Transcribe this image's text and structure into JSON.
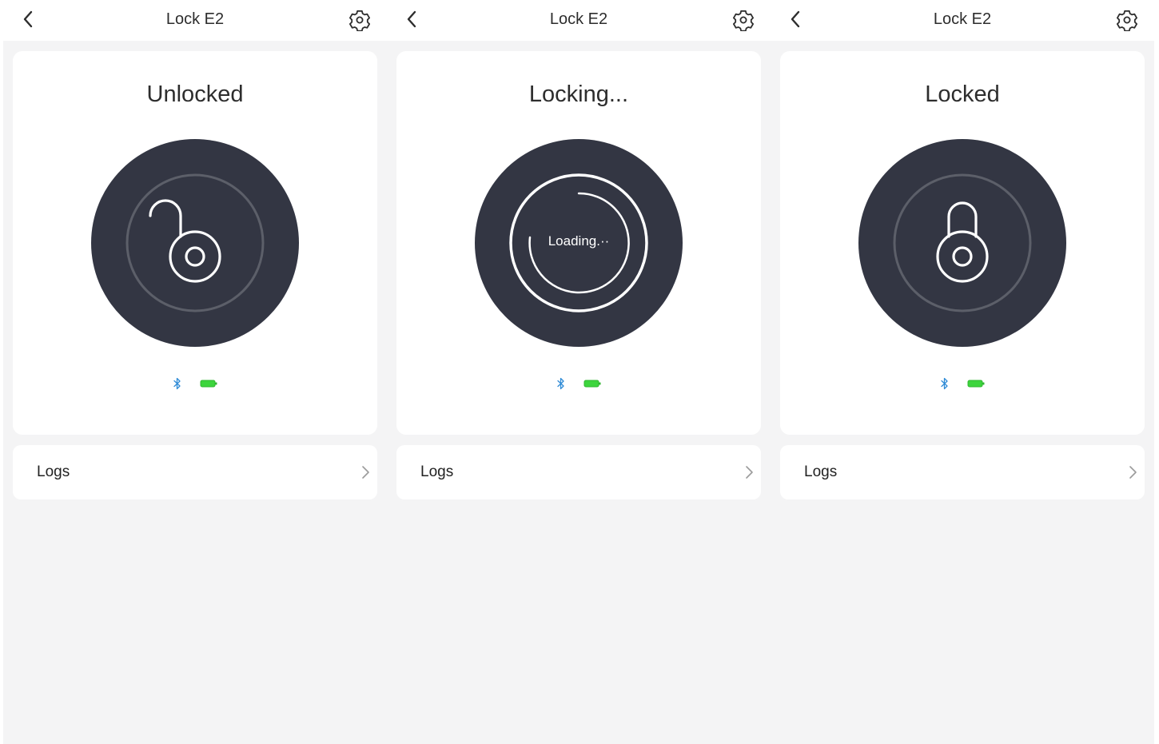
{
  "screens": [
    {
      "header": {
        "title": "Lock E2",
        "back_icon": "chevron-left-icon",
        "settings_icon": "gear-icon"
      },
      "lock": {
        "status": "Unlocked",
        "state": "unlocked",
        "loading_text": ""
      },
      "indicators": {
        "bluetooth_icon": "bluetooth-icon",
        "battery_icon": "battery-icon"
      },
      "logs": {
        "label": "Logs"
      }
    },
    {
      "header": {
        "title": "Lock E2",
        "back_icon": "chevron-left-icon",
        "settings_icon": "gear-icon"
      },
      "lock": {
        "status": "Locking...",
        "state": "locking",
        "loading_text": "Loading.··"
      },
      "indicators": {
        "bluetooth_icon": "bluetooth-icon",
        "battery_icon": "battery-icon"
      },
      "logs": {
        "label": "Logs"
      }
    },
    {
      "header": {
        "title": "Lock E2",
        "back_icon": "chevron-left-icon",
        "settings_icon": "gear-icon"
      },
      "lock": {
        "status": "Locked",
        "state": "locked",
        "loading_text": ""
      },
      "indicators": {
        "bluetooth_icon": "bluetooth-icon",
        "battery_icon": "battery-icon"
      },
      "logs": {
        "label": "Logs"
      }
    }
  ],
  "colors": {
    "page_background": "#f4f4f5",
    "card_background": "#ffffff",
    "lock_button": "#333643",
    "ring": "#5c5f69",
    "bluetooth": "#2f8bd6",
    "battery": "#3dd53d"
  }
}
